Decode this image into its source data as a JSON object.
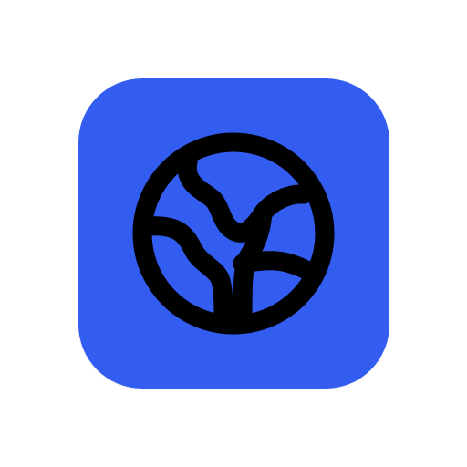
{
  "app_icon": {
    "icon": "globe-icon",
    "tile_color": "#335CF0",
    "glyph_color": "#000000",
    "background_color": "#FFFFFF"
  }
}
